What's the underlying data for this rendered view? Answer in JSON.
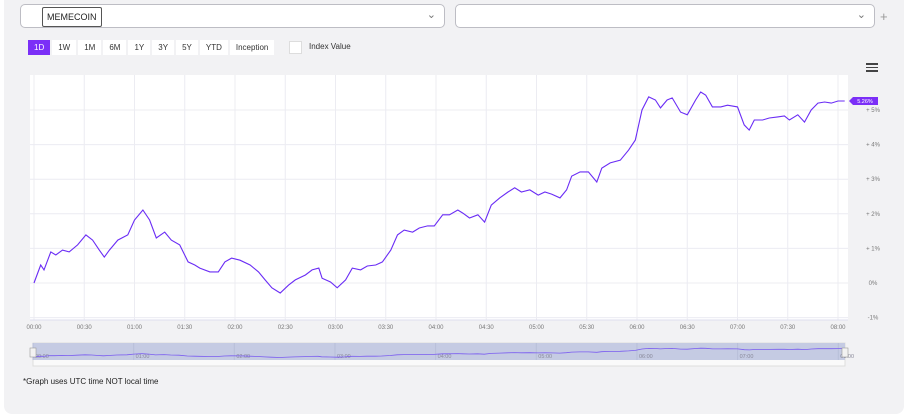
{
  "selectors": {
    "primary_value": "MEMECOIN",
    "secondary_value": "",
    "chevron": "chevron-down-icon",
    "add": "+"
  },
  "ranges": [
    {
      "label": "1D",
      "active": true
    },
    {
      "label": "1W"
    },
    {
      "label": "1M"
    },
    {
      "label": "6M"
    },
    {
      "label": "1Y"
    },
    {
      "label": "3Y"
    },
    {
      "label": "5Y"
    },
    {
      "label": "YTD"
    },
    {
      "label": "Inception"
    }
  ],
  "index_value_label": "Index Value",
  "footnote": "*Graph uses UTC time NOT local time",
  "colors": {
    "accent": "#7b2ff7",
    "line": "#6a2cf5",
    "navigator": "#c5cbe3"
  },
  "chart_data": {
    "type": "line",
    "xlabel": "",
    "ylabel": "",
    "x_unit": "minutes since 00:00 UTC",
    "xlim": [
      0,
      484
    ],
    "ylim": [
      -1,
      6.1
    ],
    "x_ticks": [
      "00:00",
      "00:30",
      "01:00",
      "01:30",
      "02:00",
      "02:30",
      "03:00",
      "03:30",
      "04:00",
      "04:30",
      "05:00",
      "05:30",
      "06:00",
      "06:30",
      "07:00",
      "07:30",
      "08:00"
    ],
    "y_ticks": [
      {
        "v": -1,
        "label": "-1%"
      },
      {
        "v": 0,
        "label": "0%"
      },
      {
        "v": 1,
        "label": "+ 1%"
      },
      {
        "v": 2,
        "label": "+ 2%"
      },
      {
        "v": 3,
        "label": "+ 3%"
      },
      {
        "v": 4,
        "label": "+ 4%"
      },
      {
        "v": 5,
        "label": "+ 5%"
      }
    ],
    "navigator_ticks": [
      "00:00",
      "01:00",
      "02:00",
      "03:00",
      "04:00",
      "05:00",
      "06:00",
      "07:00",
      "08:00"
    ],
    "last_value_label": "5.26%",
    "x": [
      0,
      4,
      6,
      10,
      13,
      17,
      21,
      26,
      31,
      35,
      39,
      42,
      45,
      50,
      56,
      60,
      65,
      69,
      73,
      78,
      82,
      87,
      92,
      96,
      99,
      105,
      110,
      114,
      118,
      123,
      129,
      134,
      138,
      142,
      147,
      152,
      156,
      162,
      166,
      170,
      172,
      177,
      181,
      186,
      190,
      195,
      199,
      204,
      208,
      213,
      217,
      221,
      226,
      230,
      235,
      239,
      244,
      248,
      253,
      256,
      260,
      265,
      269,
      273,
      278,
      283,
      287,
      291,
      296,
      301,
      305,
      309,
      314,
      318,
      321,
      326,
      331,
      336,
      339,
      344,
      350,
      355,
      359,
      363,
      367,
      371,
      374,
      378,
      381,
      386,
      390,
      395,
      398,
      401,
      405,
      410,
      414,
      420,
      424,
      427,
      430,
      435,
      439,
      444,
      448,
      451,
      456,
      460,
      464,
      468,
      472,
      476,
      480,
      484
    ],
    "y": [
      0,
      0.52,
      0.38,
      0.9,
      0.81,
      0.95,
      0.9,
      1.1,
      1.39,
      1.24,
      0.95,
      0.75,
      0.95,
      1.24,
      1.39,
      1.82,
      2.11,
      1.82,
      1.3,
      1.47,
      1.24,
      1.1,
      0.61,
      0.52,
      0.43,
      0.32,
      0.32,
      0.61,
      0.72,
      0.66,
      0.52,
      0.32,
      0.09,
      -0.14,
      -0.29,
      -0.06,
      0.09,
      0.23,
      0.38,
      0.43,
      0.14,
      0.03,
      -0.14,
      0.09,
      0.43,
      0.38,
      0.49,
      0.52,
      0.61,
      0.95,
      1.39,
      1.53,
      1.47,
      1.59,
      1.65,
      1.65,
      1.97,
      1.97,
      2.11,
      2.02,
      1.88,
      1.97,
      1.76,
      2.25,
      2.46,
      2.63,
      2.75,
      2.63,
      2.69,
      2.54,
      2.63,
      2.57,
      2.46,
      2.69,
      3.09,
      3.21,
      3.21,
      2.92,
      3.32,
      3.47,
      3.55,
      3.84,
      4.13,
      5.0,
      5.38,
      5.29,
      5.06,
      5.29,
      5.35,
      4.94,
      4.86,
      5.29,
      5.52,
      5.43,
      5.09,
      5.09,
      5.14,
      5.09,
      4.57,
      4.42,
      4.71,
      4.71,
      4.77,
      4.8,
      4.83,
      4.71,
      4.86,
      4.65,
      5.0,
      5.2,
      5.23,
      5.2,
      5.26,
      5.26
    ]
  }
}
